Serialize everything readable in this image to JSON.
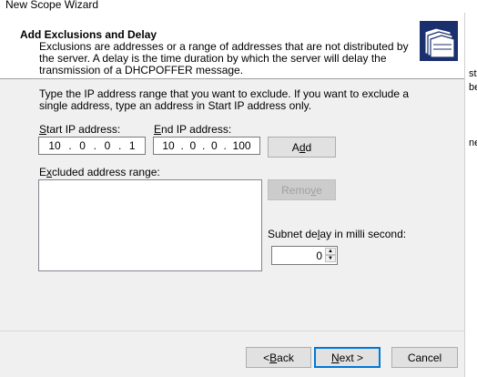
{
  "window": {
    "title": "New Scope Wizard"
  },
  "header": {
    "title": "Add Exclusions and Delay",
    "description": "Exclusions are addresses or a range of addresses that are not distributed by the server. A delay is the time duration by which the server will delay the transmission of a DHCPOFFER message.",
    "icon": "folders-icon"
  },
  "edge_text": [
    "st",
    "be",
    "ne"
  ],
  "instruction": "Type the IP address range that you want to exclude. If you want to exclude a single address, type an address in Start IP address only.",
  "start_ip": {
    "label_prefix": "",
    "label_accel": "S",
    "label_rest": "tart IP address:",
    "octets": [
      "10",
      "0",
      "0",
      "1"
    ]
  },
  "end_ip": {
    "label_prefix": "",
    "label_accel": "E",
    "label_rest": "nd IP address:",
    "octets": [
      "10",
      "0",
      "0",
      "100"
    ]
  },
  "buttons": {
    "add": {
      "pre": "A",
      "accel": "d",
      "post": "d"
    },
    "remove": {
      "pre": "Remo",
      "accel": "v",
      "post": "e"
    },
    "back": {
      "pre": "< ",
      "accel": "B",
      "post": "ack"
    },
    "next": {
      "pre": "",
      "accel": "N",
      "post": "ext >"
    },
    "cancel": "Cancel"
  },
  "excluded": {
    "label_pre": "E",
    "label_accel": "x",
    "label_post": "cluded address range:",
    "items": []
  },
  "delay": {
    "label_pre": "Subnet de",
    "label_accel": "l",
    "label_post": "ay in milli second:",
    "value": "0"
  },
  "colors": {
    "accent": "#0078d7",
    "window_bg": "#f0f0f0"
  }
}
